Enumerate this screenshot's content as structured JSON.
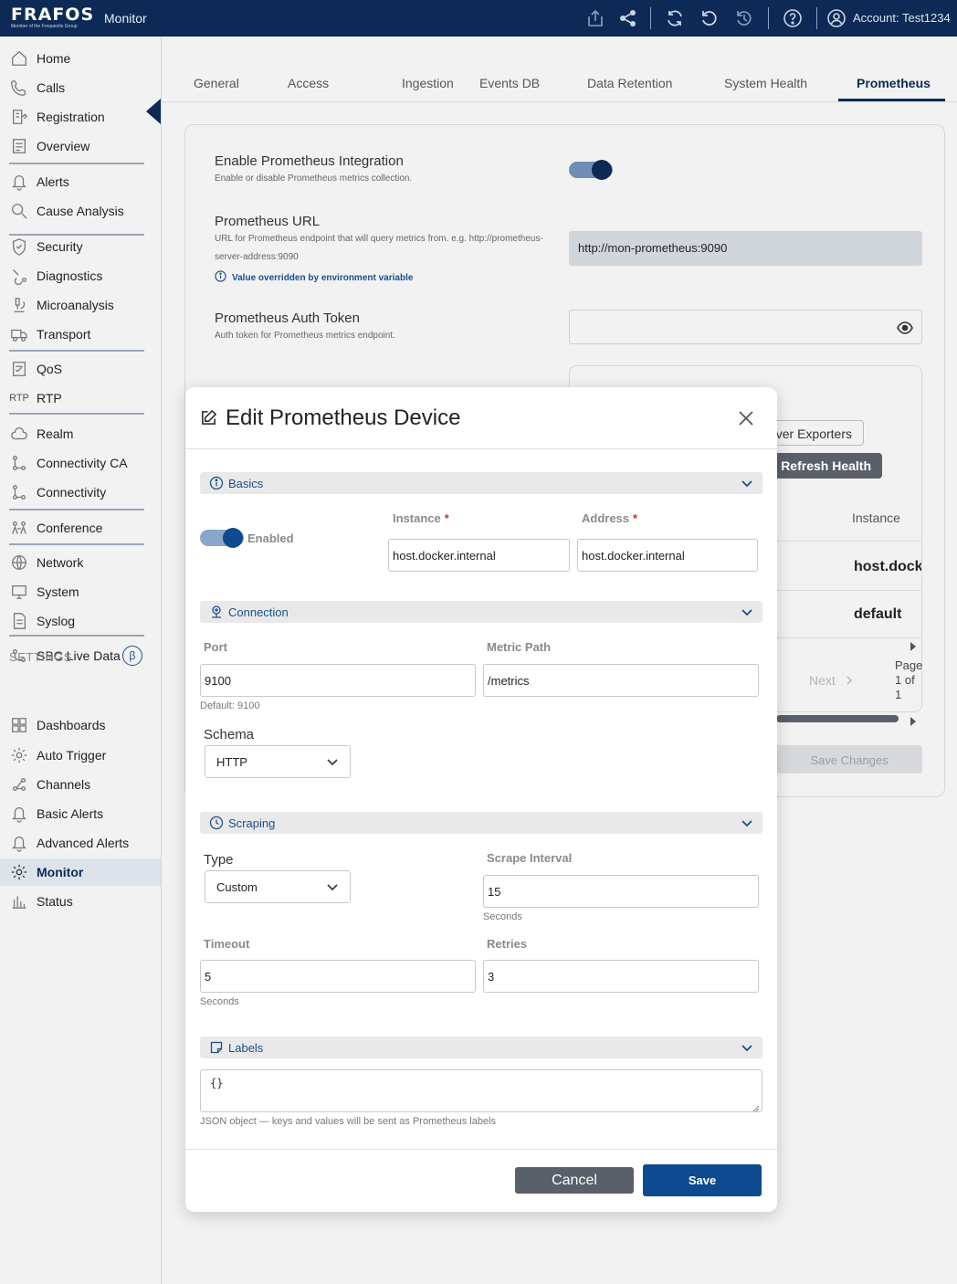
{
  "header": {
    "logo_text": "FRAFOS",
    "logo_sub": "Member of the Frequentis Group",
    "app_title": "Monitor",
    "account": "Account: Test1234"
  },
  "sidebar": {
    "items": [
      {
        "label": "Home",
        "icon": "home-icon"
      },
      {
        "label": "Calls",
        "icon": "phone-icon"
      },
      {
        "label": "Registration",
        "icon": "registration-icon"
      },
      {
        "label": "Overview",
        "icon": "overview-icon"
      },
      {
        "label": "Alerts",
        "icon": "bell-icon"
      },
      {
        "label": "Cause Analysis",
        "icon": "search-icon"
      },
      {
        "label": "Security",
        "icon": "shield-icon"
      },
      {
        "label": "Diagnostics",
        "icon": "diagnostics-icon"
      },
      {
        "label": "Microanalysis",
        "icon": "microscope-icon"
      },
      {
        "label": "Transport",
        "icon": "truck-icon"
      },
      {
        "label": "QoS",
        "icon": "qos-icon"
      },
      {
        "label": "RTP",
        "icon": "rtp-icon"
      },
      {
        "label": "Realm",
        "icon": "cloud-icon"
      },
      {
        "label": "Connectivity CA",
        "icon": "connectivity-icon"
      },
      {
        "label": "Connectivity",
        "icon": "connectivity-icon"
      },
      {
        "label": "Conference",
        "icon": "conference-icon"
      },
      {
        "label": "Network",
        "icon": "globe-icon"
      },
      {
        "label": "System",
        "icon": "monitor-icon"
      },
      {
        "label": "Syslog",
        "icon": "document-icon"
      },
      {
        "label": "SBC Live Data",
        "icon": "live-data-icon",
        "badge": "β"
      }
    ],
    "settings_header": "SETTINGS",
    "settings_items": [
      {
        "label": "Dashboards",
        "icon": "grid-icon"
      },
      {
        "label": "Auto Trigger",
        "icon": "gear-icon"
      },
      {
        "label": "Channels",
        "icon": "channels-icon"
      },
      {
        "label": "Basic Alerts",
        "icon": "bell-icon"
      },
      {
        "label": "Advanced Alerts",
        "icon": "bell-icon"
      },
      {
        "label": "Monitor",
        "icon": "gear-icon",
        "active": true
      },
      {
        "label": "Status",
        "icon": "status-icon"
      }
    ]
  },
  "tabs": [
    "General",
    "Access",
    "Ingestion",
    "Events DB",
    "Data Retention",
    "System Health",
    "Prometheus"
  ],
  "active_tab": "Prometheus",
  "settings_page": {
    "enable_title": "Enable Prometheus Integration",
    "enable_desc": "Enable or disable Prometheus metrics collection.",
    "url_title": "Prometheus URL",
    "url_desc_line1": "URL for Prometheus endpoint that will query metrics from. e.g. http://prometheus-",
    "url_desc_line2": "server-address:9090",
    "url_value": "http://mon-prometheus:9090",
    "override_note": "Value overridden by environment variable",
    "token_title": "Prometheus Auth Token",
    "token_desc": "Auth token for Prometheus metrics endpoint.",
    "exporters_button": "ver Exporters",
    "refresh_button": "Refresh Health",
    "table_column": "Instance",
    "table_rows": [
      "host.docke",
      "default"
    ],
    "next_label": "Next",
    "page_label": "Page 1 of 1",
    "save_changes": "Save Changes"
  },
  "modal": {
    "title": "Edit Prometheus Device",
    "basics": {
      "title": "Basics",
      "enabled_label": "Enabled",
      "enabled": true,
      "instance_label": "Instance",
      "instance_value": "host.docker.internal",
      "address_label": "Address",
      "address_value": "host.docker.internal",
      "required_mark": "*"
    },
    "connection": {
      "title": "Connection",
      "port_label": "Port",
      "port_value": "9100",
      "port_hint": "Default: 9100",
      "path_label": "Metric Path",
      "path_value": "/metrics",
      "schema_label": "Schema",
      "schema_value": "HTTP"
    },
    "scraping": {
      "title": "Scraping",
      "type_label": "Type",
      "type_value": "Custom",
      "interval_label": "Scrape Interval",
      "interval_value": "15",
      "interval_hint": "Seconds",
      "timeout_label": "Timeout",
      "timeout_value": "5",
      "timeout_hint": "Seconds",
      "retries_label": "Retries",
      "retries_value": "3"
    },
    "labels": {
      "title": "Labels",
      "value": "{}",
      "hint": "JSON object — keys and values will be sent as Prometheus labels"
    },
    "cancel_label": "Cancel",
    "save_label": "Save"
  },
  "colors": {
    "navy": "#0d2a56",
    "accent_blue": "#1b4f8c",
    "save_button": "#0d4a8f",
    "cancel_button": "#5a606a"
  }
}
